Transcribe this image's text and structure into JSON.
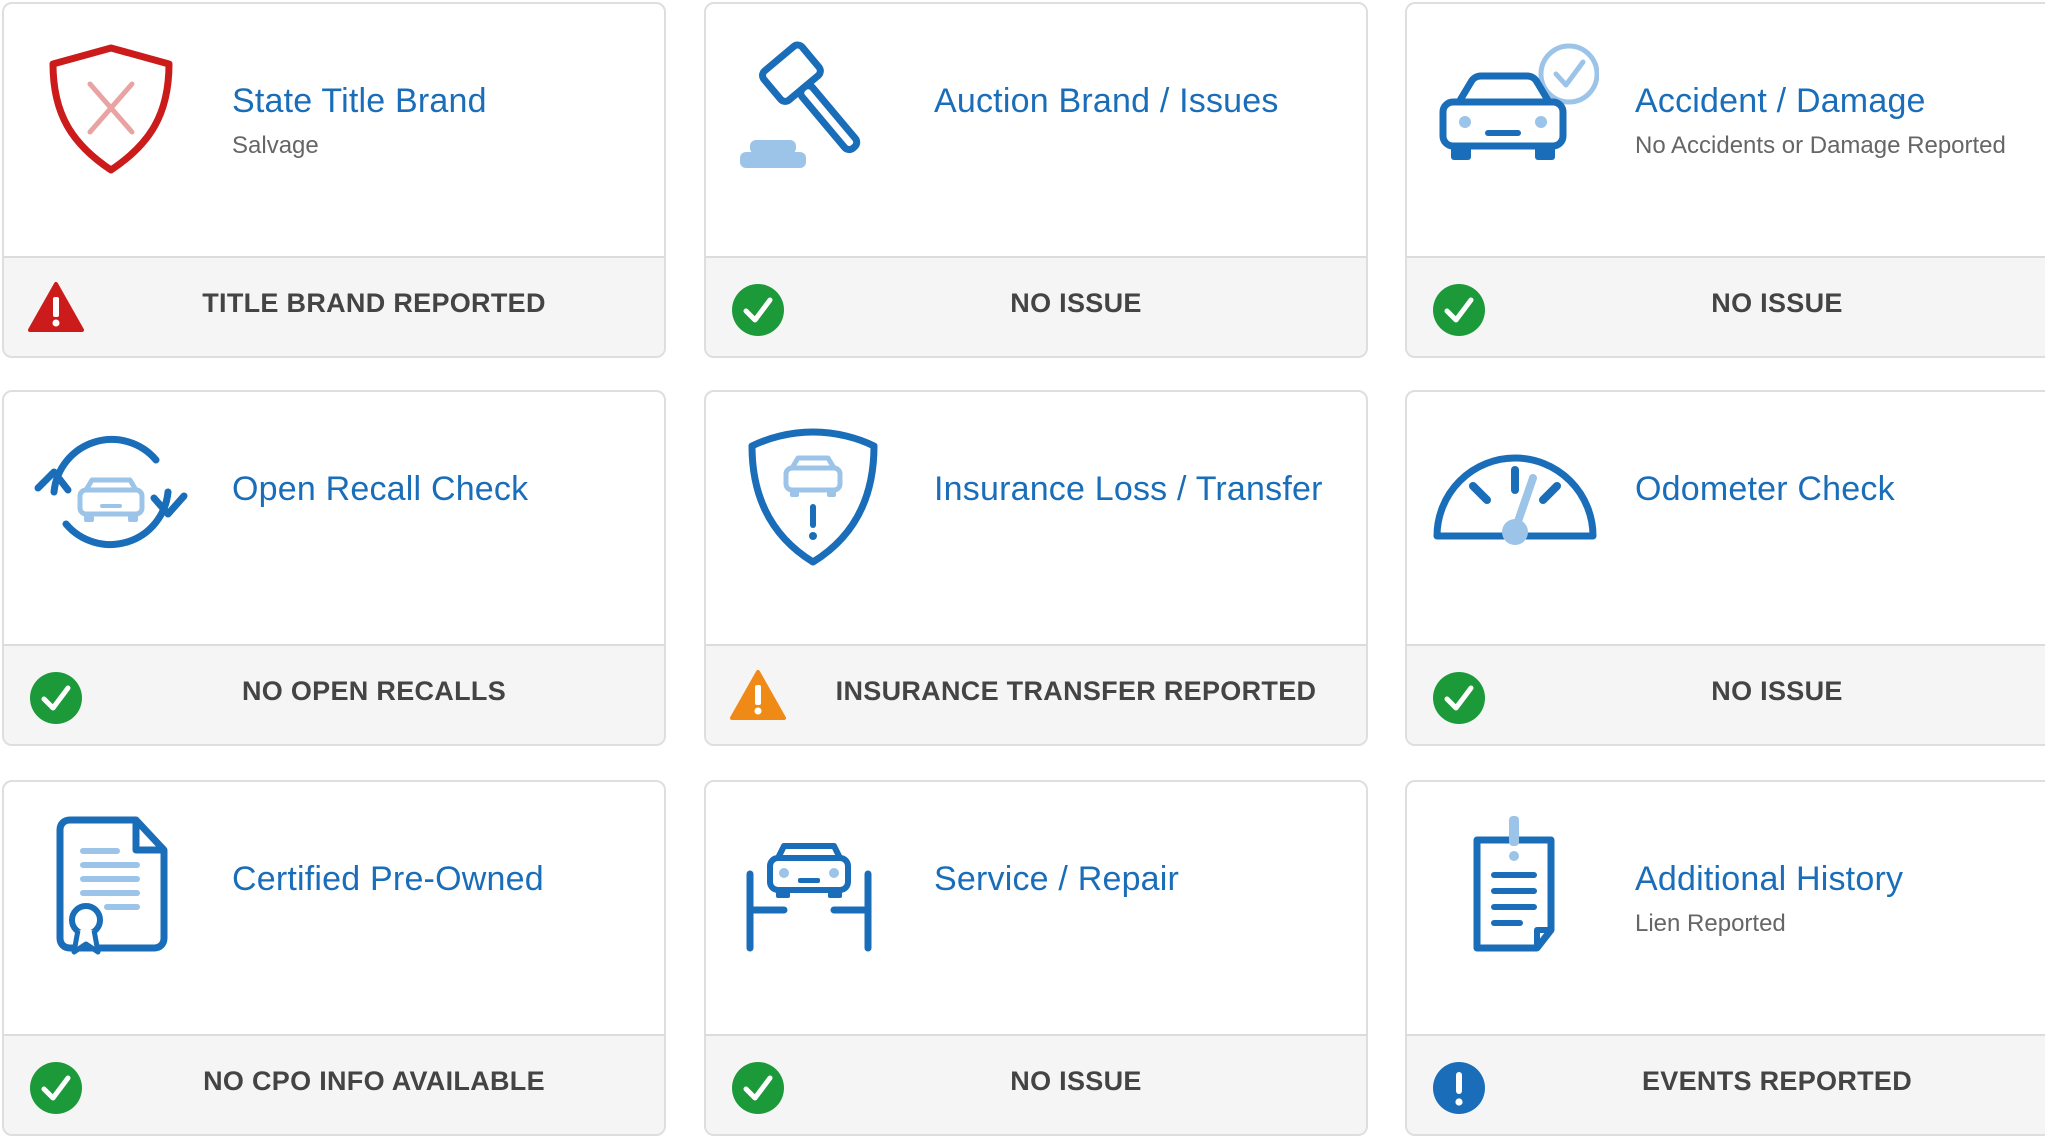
{
  "cards": [
    {
      "title": "State Title Brand",
      "subtitle": "Salvage",
      "icon": "shield-x-icon",
      "status": "TITLE BRAND REPORTED",
      "status_icon": "warning-red-icon"
    },
    {
      "title": "Auction Brand / Issues",
      "subtitle": "",
      "icon": "gavel-icon",
      "status": "NO ISSUE",
      "status_icon": "check-icon"
    },
    {
      "title": "Accident / Damage",
      "subtitle": "No Accidents or Damage Reported",
      "icon": "car-check-icon",
      "status": "NO ISSUE",
      "status_icon": "check-icon"
    },
    {
      "title": "Open Recall Check",
      "subtitle": "",
      "icon": "recall-cycle-icon",
      "status": "NO OPEN RECALLS",
      "status_icon": "check-icon"
    },
    {
      "title": "Insurance Loss / Transfer",
      "subtitle": "",
      "icon": "insurance-shield-icon",
      "status": "INSURANCE TRANSFER REPORTED",
      "status_icon": "warning-orange-icon"
    },
    {
      "title": "Odometer Check",
      "subtitle": "",
      "icon": "odometer-icon",
      "status": "NO ISSUE",
      "status_icon": "check-icon"
    },
    {
      "title": "Certified Pre-Owned",
      "subtitle": "",
      "icon": "certificate-document-icon",
      "status": "NO CPO INFO AVAILABLE",
      "status_icon": "check-icon"
    },
    {
      "title": "Service / Repair",
      "subtitle": "",
      "icon": "car-lift-icon",
      "status": "NO ISSUE",
      "status_icon": "check-icon"
    },
    {
      "title": "Additional History",
      "subtitle": "Lien Reported",
      "icon": "clipboard-alert-icon",
      "status": "EVENTS REPORTED",
      "status_icon": "info-blue-icon"
    }
  ],
  "colors": {
    "title_blue": "#1a6db8",
    "icon_blue": "#1a6db8",
    "icon_light_blue": "#9cc4e8",
    "check_green": "#1c9a3a",
    "warning_red": "#cc1b1b",
    "warning_orange": "#f08a17",
    "info_blue": "#1a6db8"
  }
}
